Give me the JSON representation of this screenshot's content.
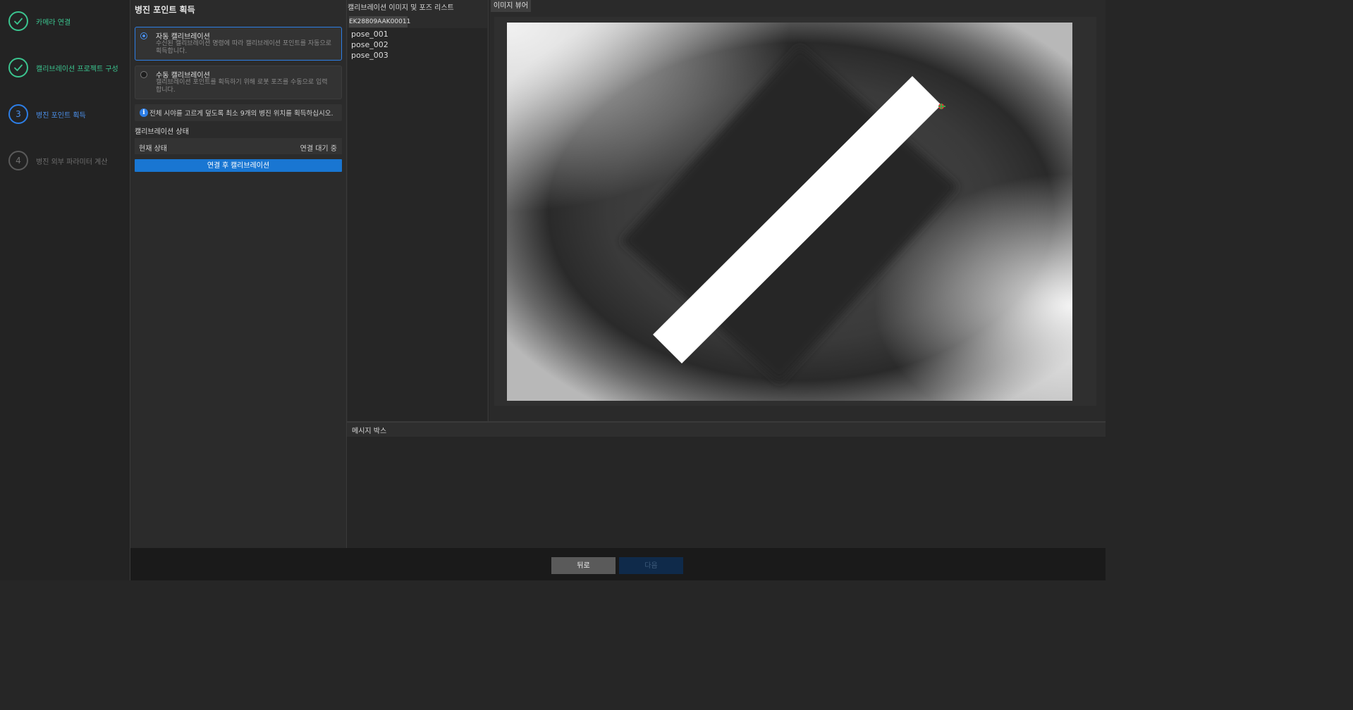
{
  "steps": [
    {
      "number": "1",
      "label": "카메라 연결",
      "state": "done"
    },
    {
      "number": "2",
      "label": "캘리브레이션 프로젝트 구성",
      "state": "done"
    },
    {
      "number": "3",
      "label": "병진 포인트 획득",
      "state": "active"
    },
    {
      "number": "4",
      "label": "병진 외부 파라미터 계산",
      "state": "todo"
    }
  ],
  "settings": {
    "title": "병진 포인트 획득",
    "auto_option": {
      "title": "자동 캘리브레이션",
      "description": "수신된 캘리브레이션 명령에 따라 캘리브레이션 포인트를 자동으로 획득합니다.",
      "selected": true
    },
    "manual_option": {
      "title": "수동 캘리브레이션",
      "description": "캘리브레이션 포인트를 획득하기 위해 로봇 포즈를 수동으로 입력합니다.",
      "selected": false
    },
    "tip": "전체 시야를 고르게 덮도록 최소 9개의 병진 위치를 획득하십시오.",
    "status_heading": "캘리브레이션 상태",
    "status_label": "현재 상태",
    "status_value": "연결 대기 중",
    "calibrate_button": "연결 후 캘리브레이션"
  },
  "pose_panel": {
    "title": "캘리브레이션 이미지 및 포즈 리스트",
    "camera_id": "EK28809AAK00011",
    "poses": [
      "pose_001",
      "pose_002",
      "pose_003"
    ]
  },
  "viewer": {
    "tab_label": "이미지 뷰어"
  },
  "message_box": {
    "title": "메시지 박스"
  },
  "footer": {
    "back_label": "뒤로",
    "next_label": "다음",
    "next_enabled": false
  },
  "colors": {
    "accent_blue": "#1976d2",
    "done_green": "#3bc48f",
    "background": "#262626"
  }
}
